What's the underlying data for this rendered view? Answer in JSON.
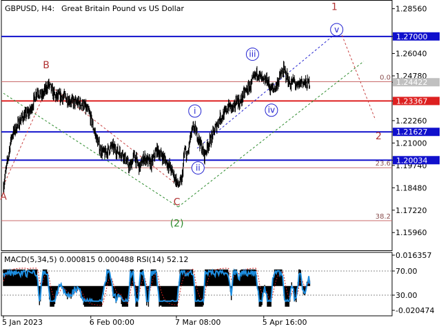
{
  "header": {
    "symbol_tf": "GBPUSD, H4:",
    "description": "Great Britain Pound vs US Dollar"
  },
  "chart_data": [
    {
      "type": "line",
      "title": "GBPUSD, H4:  Great Britain Pound vs US Dollar",
      "x_ticks": [
        "5 Jan 2023",
        "6 Feb 00:00",
        "7 Mar 08:00",
        "5 Apr 16:00"
      ],
      "x_tick_positions": [
        0,
        194,
        384,
        578
      ],
      "bar_count": 680,
      "ylim": [
        1.1496,
        1.2905
      ],
      "y_ticks": [
        "1.28560",
        "1.27000",
        "1.26040",
        "1.24780",
        "1.24422",
        "1.23367",
        "1.22260",
        "1.21627",
        "1.21000",
        "1.20034",
        "1.19740",
        "1.18480",
        "1.17220",
        "1.15960"
      ],
      "price_path": [
        [
          0,
          1.186
        ],
        [
          18,
          1.214
        ],
        [
          40,
          1.224
        ],
        [
          60,
          1.228
        ],
        [
          75,
          1.24
        ],
        [
          85,
          1.236
        ],
        [
          100,
          1.243
        ],
        [
          115,
          1.236
        ],
        [
          135,
          1.236
        ],
        [
          155,
          1.233
        ],
        [
          175,
          1.232
        ],
        [
          190,
          1.227
        ],
        [
          205,
          1.214
        ],
        [
          215,
          1.206
        ],
        [
          225,
          1.204
        ],
        [
          240,
          1.208
        ],
        [
          255,
          1.205
        ],
        [
          265,
          1.204
        ],
        [
          280,
          1.196
        ],
        [
          290,
          1.203
        ],
        [
          302,
          1.196
        ],
        [
          312,
          1.202
        ],
        [
          328,
          1.198
        ],
        [
          340,
          1.206
        ],
        [
          355,
          1.202
        ],
        [
          368,
          1.197
        ],
        [
          378,
          1.192
        ],
        [
          388,
          1.186
        ],
        [
          396,
          1.189
        ],
        [
          402,
          1.206
        ],
        [
          408,
          1.202
        ],
        [
          415,
          1.213
        ],
        [
          422,
          1.219
        ],
        [
          430,
          1.215
        ],
        [
          438,
          1.209
        ],
        [
          446,
          1.203
        ],
        [
          454,
          1.209
        ],
        [
          462,
          1.213
        ],
        [
          470,
          1.218
        ],
        [
          480,
          1.224
        ],
        [
          490,
          1.226
        ],
        [
          500,
          1.231
        ],
        [
          512,
          1.229
        ],
        [
          518,
          1.235
        ],
        [
          525,
          1.232
        ],
        [
          532,
          1.237
        ],
        [
          540,
          1.24
        ],
        [
          548,
          1.242
        ],
        [
          556,
          1.246
        ],
        [
          564,
          1.25
        ],
        [
          570,
          1.247
        ],
        [
          578,
          1.244
        ],
        [
          585,
          1.246
        ],
        [
          592,
          1.241
        ],
        [
          600,
          1.24
        ],
        [
          607,
          1.243
        ],
        [
          615,
          1.248
        ],
        [
          622,
          1.251
        ],
        [
          628,
          1.248
        ],
        [
          636,
          1.243
        ],
        [
          645,
          1.245
        ],
        [
          652,
          1.241
        ],
        [
          662,
          1.245
        ],
        [
          672,
          1.243
        ],
        [
          680,
          1.2442
        ]
      ],
      "hlines": [
        {
          "price": 1.27,
          "label": "1.27000",
          "color": "#1010cc",
          "style": "solid",
          "width": 2,
          "marker": "box"
        },
        {
          "price": 1.23367,
          "label": "1.23367",
          "color": "#dd2020",
          "style": "solid",
          "width": 2,
          "marker": "box"
        },
        {
          "price": 1.21627,
          "label": "1.21627",
          "color": "#1010cc",
          "style": "solid",
          "width": 2,
          "marker": "box"
        },
        {
          "price": 1.20034,
          "label": "1.20034",
          "color": "#1010cc",
          "style": "solid",
          "width": 2,
          "marker": "box"
        },
        {
          "price": 1.24422,
          "label": "1.24422",
          "color": "#c0c0c0",
          "style": "none",
          "width": 0,
          "marker": "current"
        }
      ],
      "fib_levels": [
        {
          "price": 1.2445,
          "label": "0.0"
        },
        {
          "price": 1.1961,
          "label": "23.6"
        },
        {
          "price": 1.1663,
          "label": "38.2"
        }
      ],
      "wave_lines": [
        {
          "color": "#c84040",
          "points": [
            [
              0,
              1.186
            ],
            [
              100,
              1.243
            ]
          ]
        },
        {
          "color": "#c84040",
          "points": [
            [
              100,
              1.243
            ],
            [
              388,
              1.186
            ]
          ]
        },
        {
          "color": "#2a8a2a",
          "points": [
            [
              0,
              1.238
            ],
            [
              388,
              1.174
            ]
          ]
        },
        {
          "color": "#2a8a2a",
          "points": [
            [
              388,
              1.174
            ],
            [
              800,
              1.256
            ]
          ]
        },
        {
          "color": "#2020d0",
          "points": [
            [
              430,
              1.207
            ],
            [
              730,
              1.27
            ]
          ]
        },
        {
          "color": "#c84040",
          "points": [
            [
              745,
              1.275
            ],
            [
              826,
              1.223
            ]
          ]
        }
      ],
      "wave_labels": [
        {
          "text": "A",
          "x": 0,
          "price": 1.18,
          "color": "#b03030",
          "circle": false,
          "paren": false
        },
        {
          "text": "B",
          "x": 95,
          "price": 1.254,
          "color": "#b03030",
          "circle": false,
          "paren": false
        },
        {
          "text": "C",
          "x": 385,
          "price": 1.177,
          "color": "#b03030",
          "circle": false,
          "paren": false
        },
        {
          "text": "(2)",
          "x": 385,
          "price": 1.165,
          "color": "#2a8a2a",
          "circle": false,
          "paren": true
        },
        {
          "text": "i",
          "x": 425,
          "price": 1.228,
          "color": "#2020d0",
          "circle": true,
          "paren": false
        },
        {
          "text": "ii",
          "x": 432,
          "price": 1.196,
          "color": "#2020d0",
          "circle": true,
          "paren": false
        },
        {
          "text": "iii",
          "x": 553,
          "price": 1.26,
          "color": "#2020d0",
          "circle": true,
          "paren": false
        },
        {
          "text": "iv",
          "x": 595,
          "price": 1.2285,
          "color": "#2020d0",
          "circle": true,
          "paren": false
        },
        {
          "text": "v",
          "x": 740,
          "price": 1.2738,
          "color": "#2020d0",
          "circle": true,
          "paren": false
        },
        {
          "text": "1",
          "x": 735,
          "price": 1.2868,
          "color": "#b03030",
          "circle": false,
          "paren": false
        },
        {
          "text": "2",
          "x": 833,
          "price": 1.214,
          "color": "#b03030",
          "circle": false,
          "paren": false
        }
      ]
    },
    {
      "type": "bar",
      "title": "MACD(5,34,5) 0.000815 0.000488 RSI(14) 52.12",
      "indicator_text": "MACD(5,34,5) 0.000815 0.000488 RSI(14) 52.12",
      "y_ticks_right": [
        "0.016357",
        "70.00",
        "30.00",
        "-0.020474"
      ],
      "macd": {
        "value": 0.000815,
        "signal": 0.000488
      },
      "rsi": {
        "period": 14,
        "value": 52.12,
        "levels": [
          70,
          30
        ]
      },
      "colors": {
        "histogram": "#000000",
        "signal": "#cc2020",
        "rsi": "#1e8ee0"
      }
    }
  ]
}
